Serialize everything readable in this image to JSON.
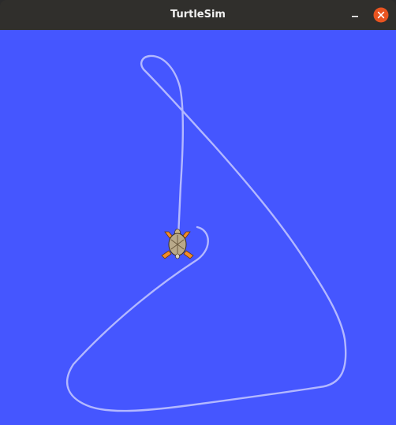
{
  "window": {
    "title": "TurtleSim"
  },
  "titlebar": {
    "minimize_icon": "minimize-icon",
    "close_icon": "close-icon",
    "close_color": "#e95420"
  },
  "canvas": {
    "background_color": "#4556ff",
    "pen_color": "#b3b8ff",
    "turtle_icon": "turtle-icon"
  }
}
